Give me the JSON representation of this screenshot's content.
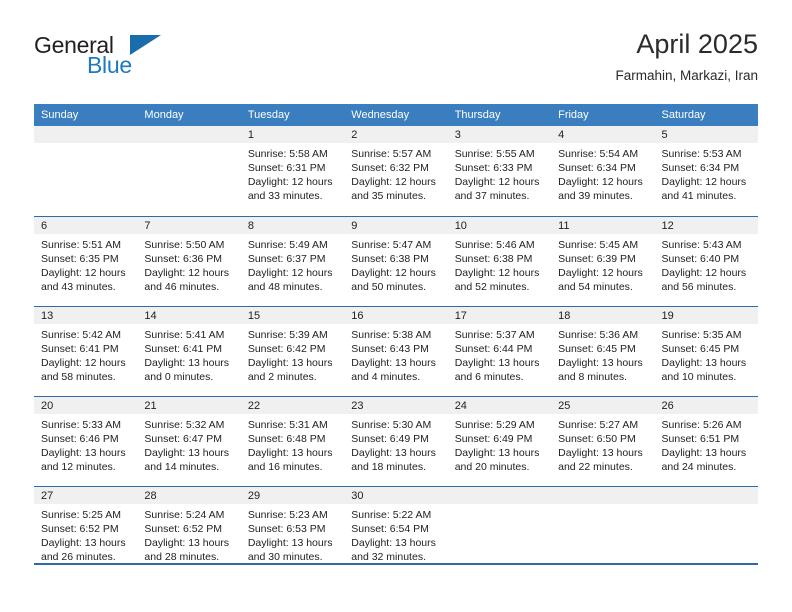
{
  "brand": {
    "name_part1": "General",
    "name_part2": "Blue",
    "triangle_icon": "triangle-logo-icon",
    "accent_color": "#1f7bc1",
    "dark_color": "#231f20"
  },
  "header": {
    "title": "April 2025",
    "subtitle": "Farmahin, Markazi, Iran"
  },
  "theme": {
    "header_bg": "#3a7ebf",
    "row_divider": "#2d6ca8",
    "daynum_band_bg": "#f0f0f0",
    "text_color": "#222222"
  },
  "weekday_headers": [
    "Sunday",
    "Monday",
    "Tuesday",
    "Wednesday",
    "Thursday",
    "Friday",
    "Saturday"
  ],
  "weeks": [
    [
      {
        "day": "",
        "sunrise": "",
        "sunset": "",
        "daylight_line1": "",
        "daylight_line2": "",
        "blank": true
      },
      {
        "day": "",
        "sunrise": "",
        "sunset": "",
        "daylight_line1": "",
        "daylight_line2": "",
        "blank": true
      },
      {
        "day": "1",
        "sunrise": "Sunrise: 5:58 AM",
        "sunset": "Sunset: 6:31 PM",
        "daylight_line1": "Daylight: 12 hours",
        "daylight_line2": "and 33 minutes."
      },
      {
        "day": "2",
        "sunrise": "Sunrise: 5:57 AM",
        "sunset": "Sunset: 6:32 PM",
        "daylight_line1": "Daylight: 12 hours",
        "daylight_line2": "and 35 minutes."
      },
      {
        "day": "3",
        "sunrise": "Sunrise: 5:55 AM",
        "sunset": "Sunset: 6:33 PM",
        "daylight_line1": "Daylight: 12 hours",
        "daylight_line2": "and 37 minutes."
      },
      {
        "day": "4",
        "sunrise": "Sunrise: 5:54 AM",
        "sunset": "Sunset: 6:34 PM",
        "daylight_line1": "Daylight: 12 hours",
        "daylight_line2": "and 39 minutes."
      },
      {
        "day": "5",
        "sunrise": "Sunrise: 5:53 AM",
        "sunset": "Sunset: 6:34 PM",
        "daylight_line1": "Daylight: 12 hours",
        "daylight_line2": "and 41 minutes."
      }
    ],
    [
      {
        "day": "6",
        "sunrise": "Sunrise: 5:51 AM",
        "sunset": "Sunset: 6:35 PM",
        "daylight_line1": "Daylight: 12 hours",
        "daylight_line2": "and 43 minutes."
      },
      {
        "day": "7",
        "sunrise": "Sunrise: 5:50 AM",
        "sunset": "Sunset: 6:36 PM",
        "daylight_line1": "Daylight: 12 hours",
        "daylight_line2": "and 46 minutes."
      },
      {
        "day": "8",
        "sunrise": "Sunrise: 5:49 AM",
        "sunset": "Sunset: 6:37 PM",
        "daylight_line1": "Daylight: 12 hours",
        "daylight_line2": "and 48 minutes."
      },
      {
        "day": "9",
        "sunrise": "Sunrise: 5:47 AM",
        "sunset": "Sunset: 6:38 PM",
        "daylight_line1": "Daylight: 12 hours",
        "daylight_line2": "and 50 minutes."
      },
      {
        "day": "10",
        "sunrise": "Sunrise: 5:46 AM",
        "sunset": "Sunset: 6:38 PM",
        "daylight_line1": "Daylight: 12 hours",
        "daylight_line2": "and 52 minutes."
      },
      {
        "day": "11",
        "sunrise": "Sunrise: 5:45 AM",
        "sunset": "Sunset: 6:39 PM",
        "daylight_line1": "Daylight: 12 hours",
        "daylight_line2": "and 54 minutes."
      },
      {
        "day": "12",
        "sunrise": "Sunrise: 5:43 AM",
        "sunset": "Sunset: 6:40 PM",
        "daylight_line1": "Daylight: 12 hours",
        "daylight_line2": "and 56 minutes."
      }
    ],
    [
      {
        "day": "13",
        "sunrise": "Sunrise: 5:42 AM",
        "sunset": "Sunset: 6:41 PM",
        "daylight_line1": "Daylight: 12 hours",
        "daylight_line2": "and 58 minutes."
      },
      {
        "day": "14",
        "sunrise": "Sunrise: 5:41 AM",
        "sunset": "Sunset: 6:41 PM",
        "daylight_line1": "Daylight: 13 hours",
        "daylight_line2": "and 0 minutes."
      },
      {
        "day": "15",
        "sunrise": "Sunrise: 5:39 AM",
        "sunset": "Sunset: 6:42 PM",
        "daylight_line1": "Daylight: 13 hours",
        "daylight_line2": "and 2 minutes."
      },
      {
        "day": "16",
        "sunrise": "Sunrise: 5:38 AM",
        "sunset": "Sunset: 6:43 PM",
        "daylight_line1": "Daylight: 13 hours",
        "daylight_line2": "and 4 minutes."
      },
      {
        "day": "17",
        "sunrise": "Sunrise: 5:37 AM",
        "sunset": "Sunset: 6:44 PM",
        "daylight_line1": "Daylight: 13 hours",
        "daylight_line2": "and 6 minutes."
      },
      {
        "day": "18",
        "sunrise": "Sunrise: 5:36 AM",
        "sunset": "Sunset: 6:45 PM",
        "daylight_line1": "Daylight: 13 hours",
        "daylight_line2": "and 8 minutes."
      },
      {
        "day": "19",
        "sunrise": "Sunrise: 5:35 AM",
        "sunset": "Sunset: 6:45 PM",
        "daylight_line1": "Daylight: 13 hours",
        "daylight_line2": "and 10 minutes."
      }
    ],
    [
      {
        "day": "20",
        "sunrise": "Sunrise: 5:33 AM",
        "sunset": "Sunset: 6:46 PM",
        "daylight_line1": "Daylight: 13 hours",
        "daylight_line2": "and 12 minutes."
      },
      {
        "day": "21",
        "sunrise": "Sunrise: 5:32 AM",
        "sunset": "Sunset: 6:47 PM",
        "daylight_line1": "Daylight: 13 hours",
        "daylight_line2": "and 14 minutes."
      },
      {
        "day": "22",
        "sunrise": "Sunrise: 5:31 AM",
        "sunset": "Sunset: 6:48 PM",
        "daylight_line1": "Daylight: 13 hours",
        "daylight_line2": "and 16 minutes."
      },
      {
        "day": "23",
        "sunrise": "Sunrise: 5:30 AM",
        "sunset": "Sunset: 6:49 PM",
        "daylight_line1": "Daylight: 13 hours",
        "daylight_line2": "and 18 minutes."
      },
      {
        "day": "24",
        "sunrise": "Sunrise: 5:29 AM",
        "sunset": "Sunset: 6:49 PM",
        "daylight_line1": "Daylight: 13 hours",
        "daylight_line2": "and 20 minutes."
      },
      {
        "day": "25",
        "sunrise": "Sunrise: 5:27 AM",
        "sunset": "Sunset: 6:50 PM",
        "daylight_line1": "Daylight: 13 hours",
        "daylight_line2": "and 22 minutes."
      },
      {
        "day": "26",
        "sunrise": "Sunrise: 5:26 AM",
        "sunset": "Sunset: 6:51 PM",
        "daylight_line1": "Daylight: 13 hours",
        "daylight_line2": "and 24 minutes."
      }
    ],
    [
      {
        "day": "27",
        "sunrise": "Sunrise: 5:25 AM",
        "sunset": "Sunset: 6:52 PM",
        "daylight_line1": "Daylight: 13 hours",
        "daylight_line2": "and 26 minutes."
      },
      {
        "day": "28",
        "sunrise": "Sunrise: 5:24 AM",
        "sunset": "Sunset: 6:52 PM",
        "daylight_line1": "Daylight: 13 hours",
        "daylight_line2": "and 28 minutes."
      },
      {
        "day": "29",
        "sunrise": "Sunrise: 5:23 AM",
        "sunset": "Sunset: 6:53 PM",
        "daylight_line1": "Daylight: 13 hours",
        "daylight_line2": "and 30 minutes."
      },
      {
        "day": "30",
        "sunrise": "Sunrise: 5:22 AM",
        "sunset": "Sunset: 6:54 PM",
        "daylight_line1": "Daylight: 13 hours",
        "daylight_line2": "and 32 minutes."
      },
      {
        "day": "",
        "sunrise": "",
        "sunset": "",
        "daylight_line1": "",
        "daylight_line2": "",
        "blank": true
      },
      {
        "day": "",
        "sunrise": "",
        "sunset": "",
        "daylight_line1": "",
        "daylight_line2": "",
        "blank": true
      },
      {
        "day": "",
        "sunrise": "",
        "sunset": "",
        "daylight_line1": "",
        "daylight_line2": "",
        "blank": true
      }
    ]
  ]
}
